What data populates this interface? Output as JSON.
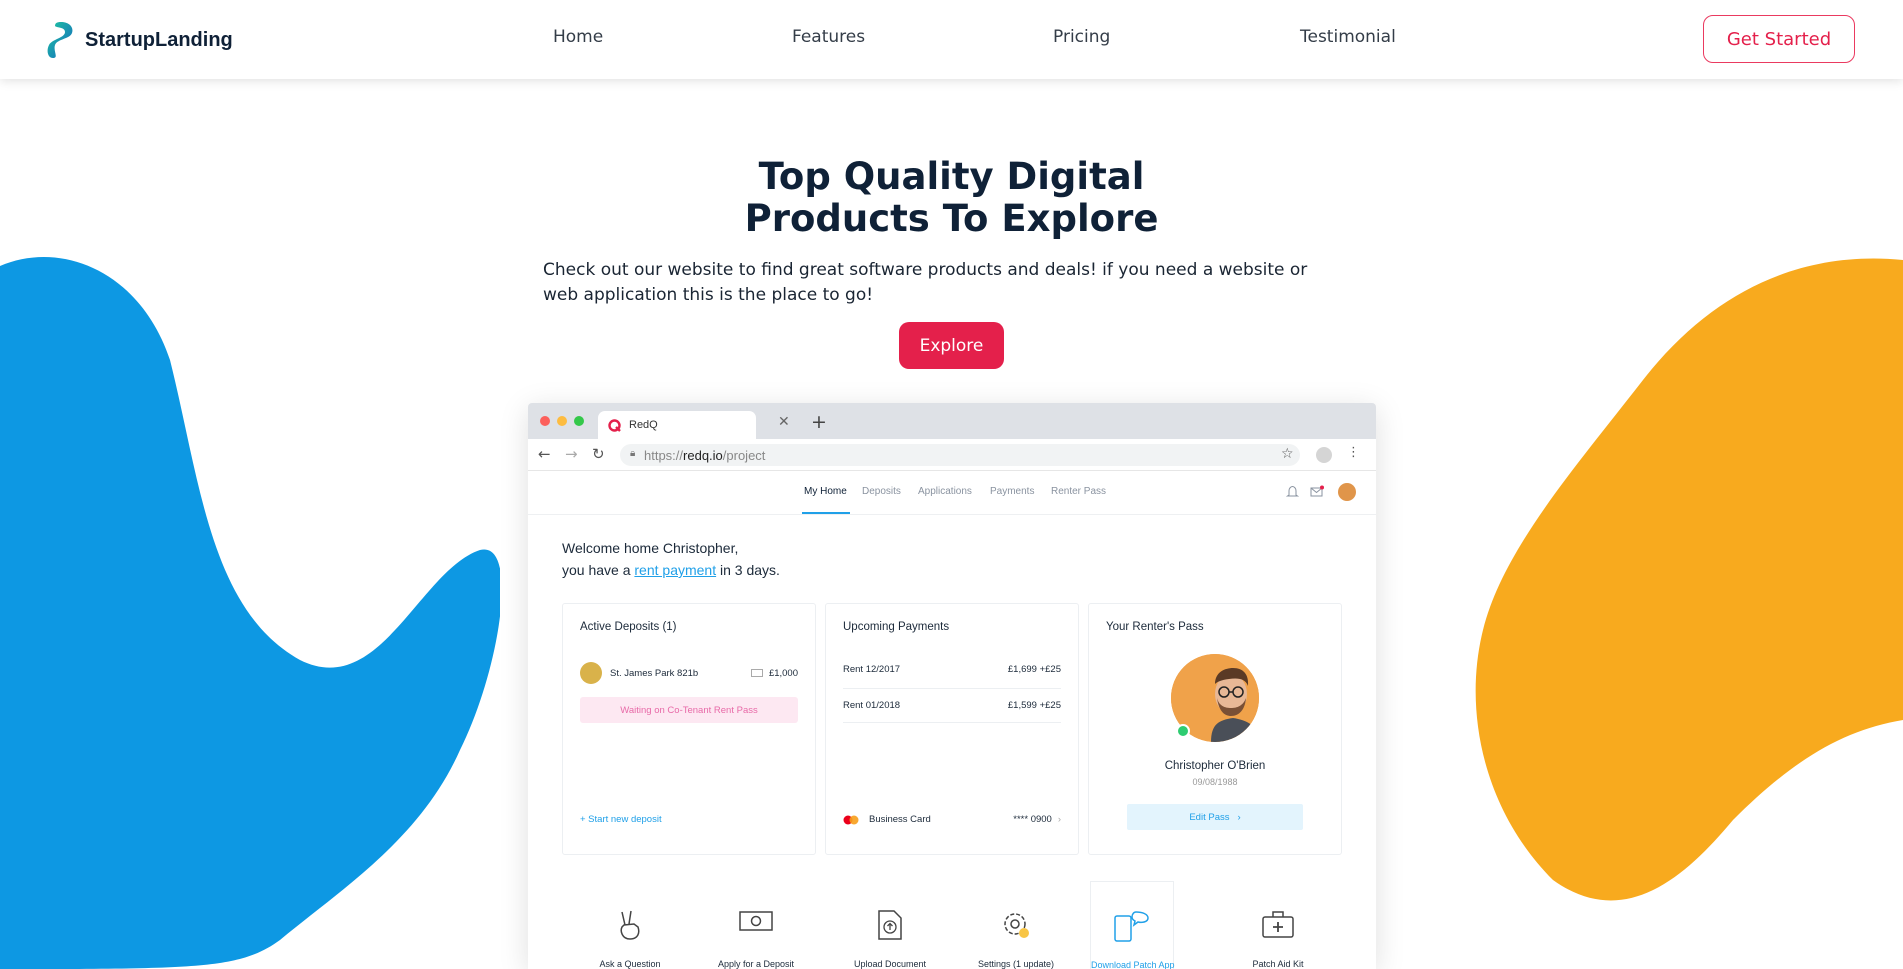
{
  "brand": {
    "name": "StartupLanding"
  },
  "nav": {
    "items": [
      "Home",
      "Features",
      "Pricing",
      "Testimonial"
    ],
    "cta": "Get Started"
  },
  "hero": {
    "title_line1": "Top Quality Digital",
    "title_line2": "Products To Explore",
    "subtitle": "Check out our website to find great software products and deals! if you need a website or web application this is the place to go!",
    "button": "Explore"
  },
  "colors": {
    "accent": "#e4204b",
    "blue_blob": "#0d98e3",
    "yellow_blob": "#f8aa1e",
    "link": "#20a0e8"
  },
  "browser": {
    "tab_title": "RedQ",
    "url_scheme": "https://",
    "url_host": "redq.io",
    "url_path": "/project",
    "app_nav": [
      "My Home",
      "Deposits",
      "Applications",
      "Payments",
      "Renter Pass"
    ],
    "welcome_line1": "Welcome home Christopher,",
    "welcome_pre": "you have a",
    "welcome_link": "rent payment",
    "welcome_post": "in 3 days.",
    "deposits": {
      "title": "Active Deposits (1)",
      "property": "St. James Park 821b",
      "amount": "£1,000",
      "status": "Waiting on Co-Tenant Rent Pass",
      "link": "+ Start new deposit"
    },
    "payments": {
      "title": "Upcoming Payments",
      "rows": [
        {
          "label": "Rent 12/2017",
          "value": "£1,699  +£25"
        },
        {
          "label": "Rent 01/2018",
          "value": "£1,599  +£25"
        }
      ],
      "card_label": "Business Card",
      "card_value": "**** 0900"
    },
    "renter_pass": {
      "title": "Your Renter's Pass",
      "name": "Christopher O'Brien",
      "date": "09/08/1988",
      "button": "Edit Pass"
    },
    "actions": [
      "Ask a Question",
      "Apply for a Deposit",
      "Upload Document",
      "Settings (1 update)",
      "Download Patch App",
      "Patch Aid Kit"
    ]
  }
}
